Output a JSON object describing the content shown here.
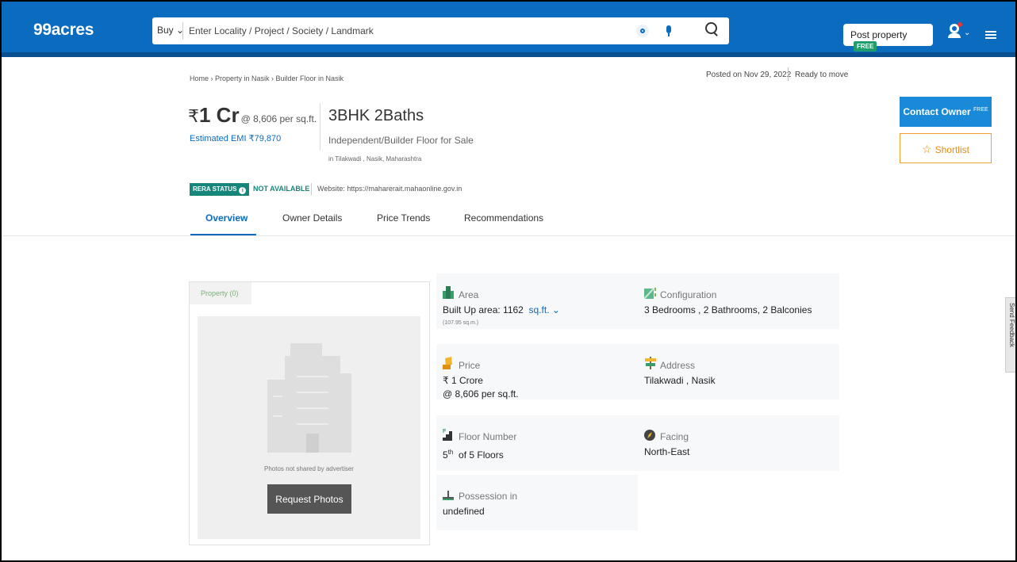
{
  "header": {
    "logo": "99acres",
    "search": {
      "mode": "Buy",
      "placeholder": "Enter Locality / Project / Society / Landmark"
    },
    "post_property": "Post property",
    "post_badge": "FREE",
    "colors": {
      "header_bg": "#0a6bbf",
      "free_badge": "#1f9d6b"
    }
  },
  "breadcrumb": "Home › Property in Nasik › Builder Floor in Nasik",
  "posted_on": "Posted on Nov 29, 2022",
  "status": "Ready to move",
  "price": {
    "symbol": "₹",
    "amount": "1 Cr",
    "per_sqft": "@ 8,606 per sq.ft.",
    "emi": "Estimated EMI ₹79,870"
  },
  "property": {
    "bhk": "3BHK 2Baths",
    "type": "Independent/Builder Floor for Sale",
    "location": "in Tilakwadi , Nasik, Maharashtra"
  },
  "rera": {
    "label": "RERA STATUS",
    "status": "NOT AVAILABLE",
    "website": "Website: https://maharerait.mahaonline.gov.in"
  },
  "tabs": [
    "Overview",
    "Owner Details",
    "Price Trends",
    "Recommendations"
  ],
  "actions": {
    "contact": "Contact Owner",
    "contact_badge": "FREE",
    "shortlist": "Shortlist"
  },
  "photos": {
    "tab": "Property (0)",
    "message": "Photos not shared by advertiser",
    "request": "Request Photos"
  },
  "details": {
    "area": {
      "label": "Area",
      "value": "Built Up area: 1162",
      "unit": "sq.ft.",
      "sub": "(107.95 sq.m.)"
    },
    "configuration": {
      "label": "Configuration",
      "value": "3 Bedrooms , 2 Bathrooms, 2 Balconies"
    },
    "price": {
      "label": "Price",
      "value": "₹ 1 Crore",
      "sub": "@ 8,606 per sq.ft."
    },
    "address": {
      "label": "Address",
      "value": "Tilakwadi , Nasik"
    },
    "floor": {
      "label": "Floor Number",
      "value": "5",
      "sup": "th",
      "suffix": "of 5 Floors"
    },
    "facing": {
      "label": "Facing",
      "value": "North-East"
    },
    "possession": {
      "label": "Possession in",
      "value": "undefined"
    }
  },
  "feedback": "Send Feedback"
}
